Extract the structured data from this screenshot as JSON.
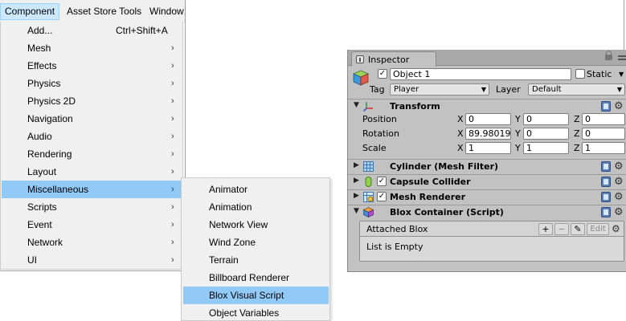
{
  "menubar": {
    "items": [
      {
        "label": "Component",
        "active": true
      },
      {
        "label": "Asset Store Tools",
        "active": false
      },
      {
        "label": "Window",
        "active": false
      }
    ]
  },
  "component_menu": {
    "highlight_color": "#91c9f7",
    "items": [
      {
        "label": "Add...",
        "shortcut": "Ctrl+Shift+A",
        "has_submenu": false
      },
      {
        "label": "Mesh",
        "has_submenu": true
      },
      {
        "label": "Effects",
        "has_submenu": true
      },
      {
        "label": "Physics",
        "has_submenu": true
      },
      {
        "label": "Physics 2D",
        "has_submenu": true
      },
      {
        "label": "Navigation",
        "has_submenu": true
      },
      {
        "label": "Audio",
        "has_submenu": true
      },
      {
        "label": "Rendering",
        "has_submenu": true
      },
      {
        "label": "Layout",
        "has_submenu": true
      },
      {
        "label": "Miscellaneous",
        "has_submenu": true,
        "highlighted": true
      },
      {
        "label": "Scripts",
        "has_submenu": true
      },
      {
        "label": "Event",
        "has_submenu": true
      },
      {
        "label": "Network",
        "has_submenu": true
      },
      {
        "label": "UI",
        "has_submenu": true
      }
    ],
    "arrow_glyph": "›"
  },
  "misc_submenu": {
    "items": [
      {
        "label": "Animator"
      },
      {
        "label": "Animation"
      },
      {
        "label": "Network View"
      },
      {
        "label": "Wind Zone"
      },
      {
        "label": "Terrain"
      },
      {
        "label": "Billboard Renderer"
      },
      {
        "label": "Blox Visual Script",
        "highlighted": true
      },
      {
        "label": "Object Variables"
      }
    ]
  },
  "inspector": {
    "tab_label": "Inspector",
    "object_name": "Object 1",
    "active_checked": true,
    "static_label": "Static",
    "static_checked": false,
    "tag_label": "Tag",
    "tag_value": "Player",
    "layer_label": "Layer",
    "layer_value": "Default",
    "transform": {
      "title": "Transform",
      "position": {
        "label": "Position",
        "x": "0",
        "y": "0",
        "z": "0"
      },
      "rotation": {
        "label": "Rotation",
        "x": "89.98019",
        "y": "0",
        "z": "0"
      },
      "scale": {
        "label": "Scale",
        "x": "1",
        "y": "1",
        "z": "1"
      },
      "axis_x": "X",
      "axis_y": "Y",
      "axis_z": "Z"
    },
    "components": [
      {
        "title": "Cylinder (Mesh Filter)",
        "has_checkbox": false
      },
      {
        "title": "Capsule Collider",
        "has_checkbox": true
      },
      {
        "title": "Mesh Renderer",
        "has_checkbox": true
      },
      {
        "title": "Blox Container (Script)",
        "has_checkbox": false
      }
    ],
    "blox": {
      "list_title": "Attached Blox",
      "add_label": "+",
      "remove_label": "−",
      "edit_label": "Edit",
      "empty_text": "List is Empty"
    }
  }
}
